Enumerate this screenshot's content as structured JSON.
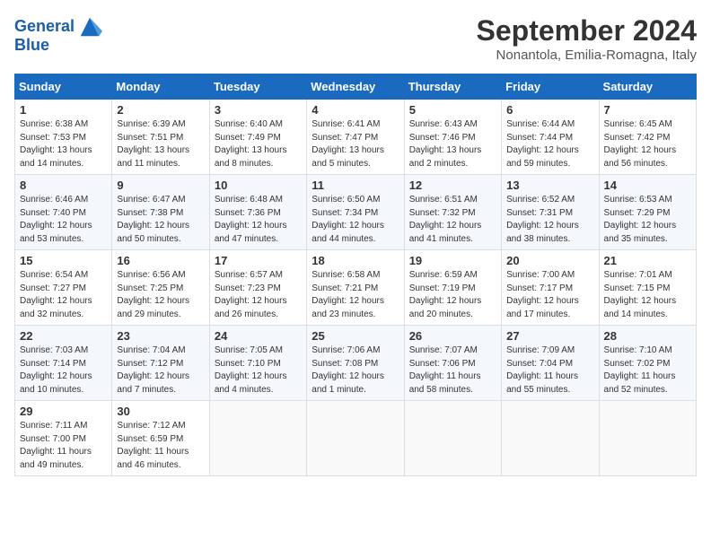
{
  "header": {
    "logo_line1": "General",
    "logo_line2": "Blue",
    "month_title": "September 2024",
    "subtitle": "Nonantola, Emilia-Romagna, Italy"
  },
  "weekdays": [
    "Sunday",
    "Monday",
    "Tuesday",
    "Wednesday",
    "Thursday",
    "Friday",
    "Saturday"
  ],
  "weeks": [
    [
      {
        "day": "1",
        "sunrise": "6:38 AM",
        "sunset": "7:53 PM",
        "daylight": "13 hours and 14 minutes."
      },
      {
        "day": "2",
        "sunrise": "6:39 AM",
        "sunset": "7:51 PM",
        "daylight": "13 hours and 11 minutes."
      },
      {
        "day": "3",
        "sunrise": "6:40 AM",
        "sunset": "7:49 PM",
        "daylight": "13 hours and 8 minutes."
      },
      {
        "day": "4",
        "sunrise": "6:41 AM",
        "sunset": "7:47 PM",
        "daylight": "13 hours and 5 minutes."
      },
      {
        "day": "5",
        "sunrise": "6:43 AM",
        "sunset": "7:46 PM",
        "daylight": "13 hours and 2 minutes."
      },
      {
        "day": "6",
        "sunrise": "6:44 AM",
        "sunset": "7:44 PM",
        "daylight": "12 hours and 59 minutes."
      },
      {
        "day": "7",
        "sunrise": "6:45 AM",
        "sunset": "7:42 PM",
        "daylight": "12 hours and 56 minutes."
      }
    ],
    [
      {
        "day": "8",
        "sunrise": "6:46 AM",
        "sunset": "7:40 PM",
        "daylight": "12 hours and 53 minutes."
      },
      {
        "day": "9",
        "sunrise": "6:47 AM",
        "sunset": "7:38 PM",
        "daylight": "12 hours and 50 minutes."
      },
      {
        "day": "10",
        "sunrise": "6:48 AM",
        "sunset": "7:36 PM",
        "daylight": "12 hours and 47 minutes."
      },
      {
        "day": "11",
        "sunrise": "6:50 AM",
        "sunset": "7:34 PM",
        "daylight": "12 hours and 44 minutes."
      },
      {
        "day": "12",
        "sunrise": "6:51 AM",
        "sunset": "7:32 PM",
        "daylight": "12 hours and 41 minutes."
      },
      {
        "day": "13",
        "sunrise": "6:52 AM",
        "sunset": "7:31 PM",
        "daylight": "12 hours and 38 minutes."
      },
      {
        "day": "14",
        "sunrise": "6:53 AM",
        "sunset": "7:29 PM",
        "daylight": "12 hours and 35 minutes."
      }
    ],
    [
      {
        "day": "15",
        "sunrise": "6:54 AM",
        "sunset": "7:27 PM",
        "daylight": "12 hours and 32 minutes."
      },
      {
        "day": "16",
        "sunrise": "6:56 AM",
        "sunset": "7:25 PM",
        "daylight": "12 hours and 29 minutes."
      },
      {
        "day": "17",
        "sunrise": "6:57 AM",
        "sunset": "7:23 PM",
        "daylight": "12 hours and 26 minutes."
      },
      {
        "day": "18",
        "sunrise": "6:58 AM",
        "sunset": "7:21 PM",
        "daylight": "12 hours and 23 minutes."
      },
      {
        "day": "19",
        "sunrise": "6:59 AM",
        "sunset": "7:19 PM",
        "daylight": "12 hours and 20 minutes."
      },
      {
        "day": "20",
        "sunrise": "7:00 AM",
        "sunset": "7:17 PM",
        "daylight": "12 hours and 17 minutes."
      },
      {
        "day": "21",
        "sunrise": "7:01 AM",
        "sunset": "7:15 PM",
        "daylight": "12 hours and 14 minutes."
      }
    ],
    [
      {
        "day": "22",
        "sunrise": "7:03 AM",
        "sunset": "7:14 PM",
        "daylight": "12 hours and 10 minutes."
      },
      {
        "day": "23",
        "sunrise": "7:04 AM",
        "sunset": "7:12 PM",
        "daylight": "12 hours and 7 minutes."
      },
      {
        "day": "24",
        "sunrise": "7:05 AM",
        "sunset": "7:10 PM",
        "daylight": "12 hours and 4 minutes."
      },
      {
        "day": "25",
        "sunrise": "7:06 AM",
        "sunset": "7:08 PM",
        "daylight": "12 hours and 1 minute."
      },
      {
        "day": "26",
        "sunrise": "7:07 AM",
        "sunset": "7:06 PM",
        "daylight": "11 hours and 58 minutes."
      },
      {
        "day": "27",
        "sunrise": "7:09 AM",
        "sunset": "7:04 PM",
        "daylight": "11 hours and 55 minutes."
      },
      {
        "day": "28",
        "sunrise": "7:10 AM",
        "sunset": "7:02 PM",
        "daylight": "11 hours and 52 minutes."
      }
    ],
    [
      {
        "day": "29",
        "sunrise": "7:11 AM",
        "sunset": "7:00 PM",
        "daylight": "11 hours and 49 minutes."
      },
      {
        "day": "30",
        "sunrise": "7:12 AM",
        "sunset": "6:59 PM",
        "daylight": "11 hours and 46 minutes."
      },
      null,
      null,
      null,
      null,
      null
    ]
  ]
}
